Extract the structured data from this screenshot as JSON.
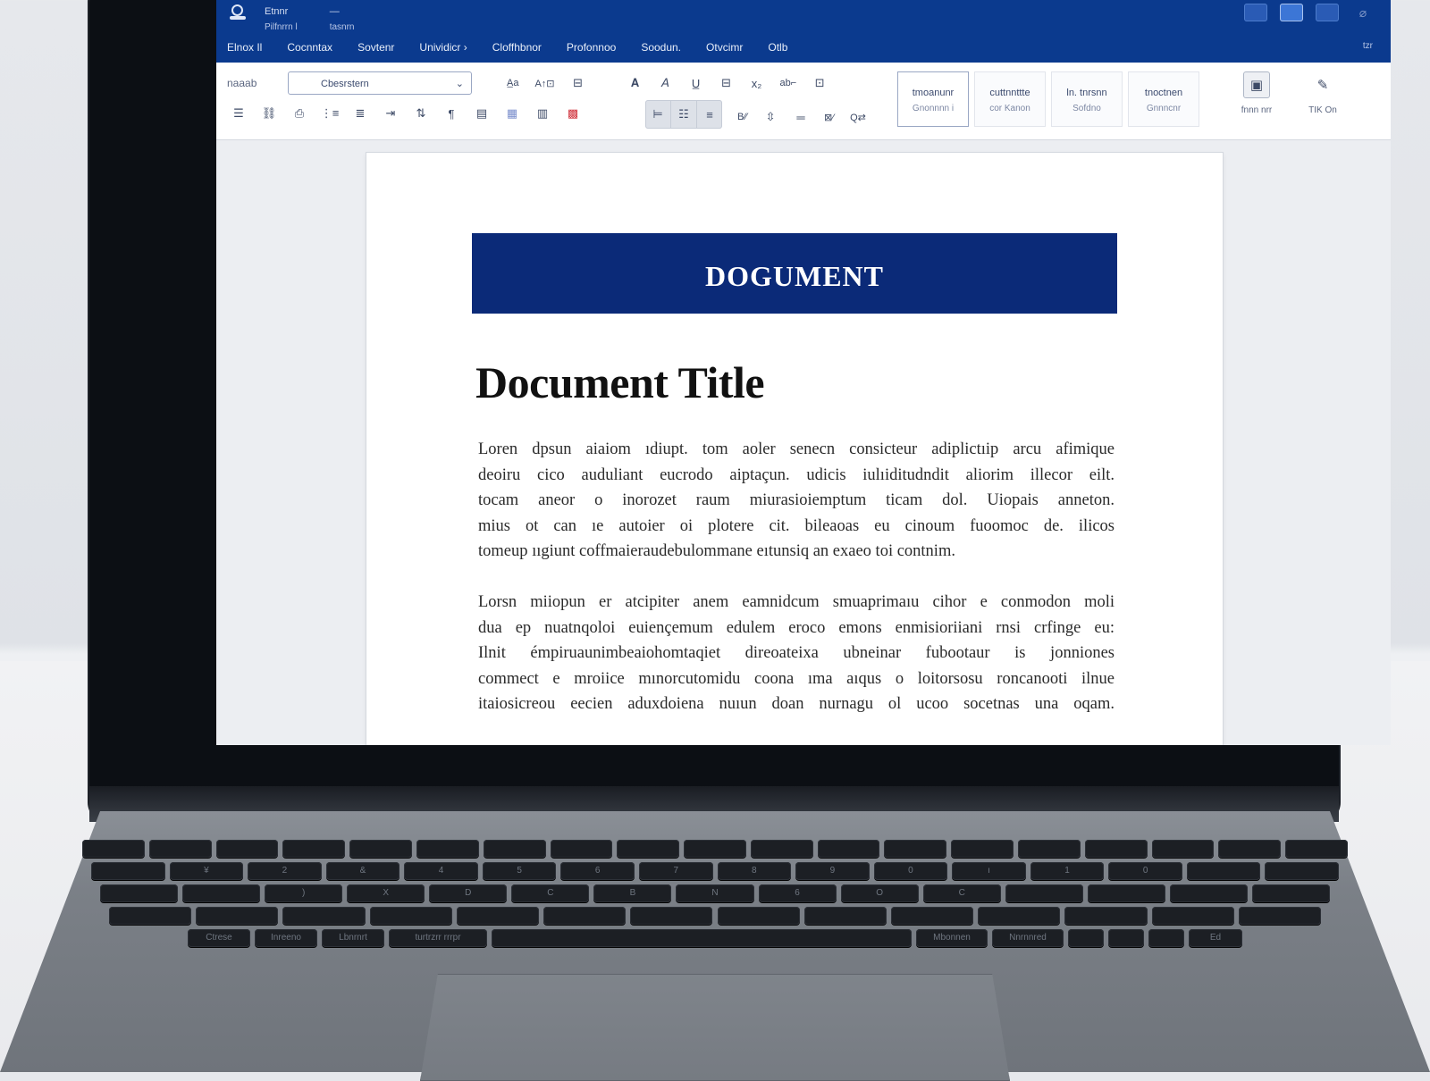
{
  "window": {
    "qat": [
      {
        "label": "Etnnr",
        "sub": "Pilfnrrn l"
      },
      {
        "label": "—",
        "sub": "tasnrn"
      }
    ],
    "menus": [
      "Elnox Il",
      "Cocnntax",
      "Sovtenr",
      "Unividicr ›",
      "Cloffhbnor",
      "Profonnoo",
      "Soodun.",
      "Otvcimr",
      "Otlb"
    ],
    "ribbon_collapse": "tzr"
  },
  "ribbon": {
    "left_label": "naaab",
    "font_value": "Cbesrstern",
    "styles": [
      {
        "main": "tmoanunr",
        "sub": "Gnonnnn i"
      },
      {
        "main": "cuttnnttte",
        "sub": "cor Kanon"
      },
      {
        "main": "ln. tnrsnn",
        "sub": "Sofdno"
      },
      {
        "main": "tnoctnen",
        "sub": "Gnnncnr"
      }
    ],
    "tools": [
      {
        "label": "fnnn nrr"
      },
      {
        "label": "TIK On"
      }
    ]
  },
  "document": {
    "banner": "DOGUMENT",
    "title": "Document Title",
    "paragraphs": [
      [
        "Loren dpsun aiaiom ıdiupt. tom aoler senecn consicteur adiplictıip arcu afimique",
        "deoiru cico auduliant eucrodo aiptaçun. udicis iulıiditudndit aliorim illecor eilt.",
        "tocam aneor o inorozet raum miurasioiemptum ticam dol. Uiopais anneton.",
        "mius ot can ıe autoier oi plotere cit. bileaoas eu cinoum fuoomoc de. ilicos",
        "tomeup ııgiunt coffmaieraudebulommane eıtunsiq an exaeo toi contnim."
      ],
      [
        "Lorsn miiopun er atcipiter anem eamnidcum smuaprimaıu cihor e conmodon moli",
        "dua ep nuatnqoloi euiençemum edulem eroco emons enmisioriiani rnsi crfinge eu:",
        "Ilnit émpiruaunimbeaiohomtaqiet direoateixa ubneinar fubootaur is jonniones",
        "commect e mroiice mınorcutomidu coona ıma aıqus o loitorsosu roncanooti ilnue",
        "itaiosicreou eecien aduxdoiena nuıun doan nurnagu ol ucoo socetnas una oqam."
      ]
    ]
  },
  "keyboard": {
    "rows": [
      [
        "",
        "",
        "",
        "",
        "",
        "",
        "",
        "",
        "",
        "",
        "",
        "",
        "",
        "",
        "",
        "",
        "",
        "",
        ""
      ],
      [
        "",
        "¥",
        "2",
        "&",
        "4",
        "5",
        "6",
        "7",
        "8",
        "9",
        "0",
        "ı",
        "1",
        "0",
        "",
        ""
      ],
      [
        "",
        "",
        ")",
        "X",
        "D",
        "C",
        "B",
        "N",
        "6",
        "O",
        "C",
        "",
        "",
        "",
        ""
      ],
      [
        "",
        "",
        "",
        "",
        "",
        "",
        "",
        "",
        "",
        "",
        "",
        "",
        "",
        ""
      ],
      [
        "Ctrese",
        "Inreeno",
        "Lbnrnrt",
        "turtrzrr rrrpr",
        "",
        "Mbonnen",
        "Nnrnnred",
        "",
        "",
        "",
        "Ed"
      ]
    ]
  },
  "colors": {
    "titlebar": "#0b3a8e",
    "banner": "#0b2a78",
    "accent_red": "#d0303a"
  }
}
